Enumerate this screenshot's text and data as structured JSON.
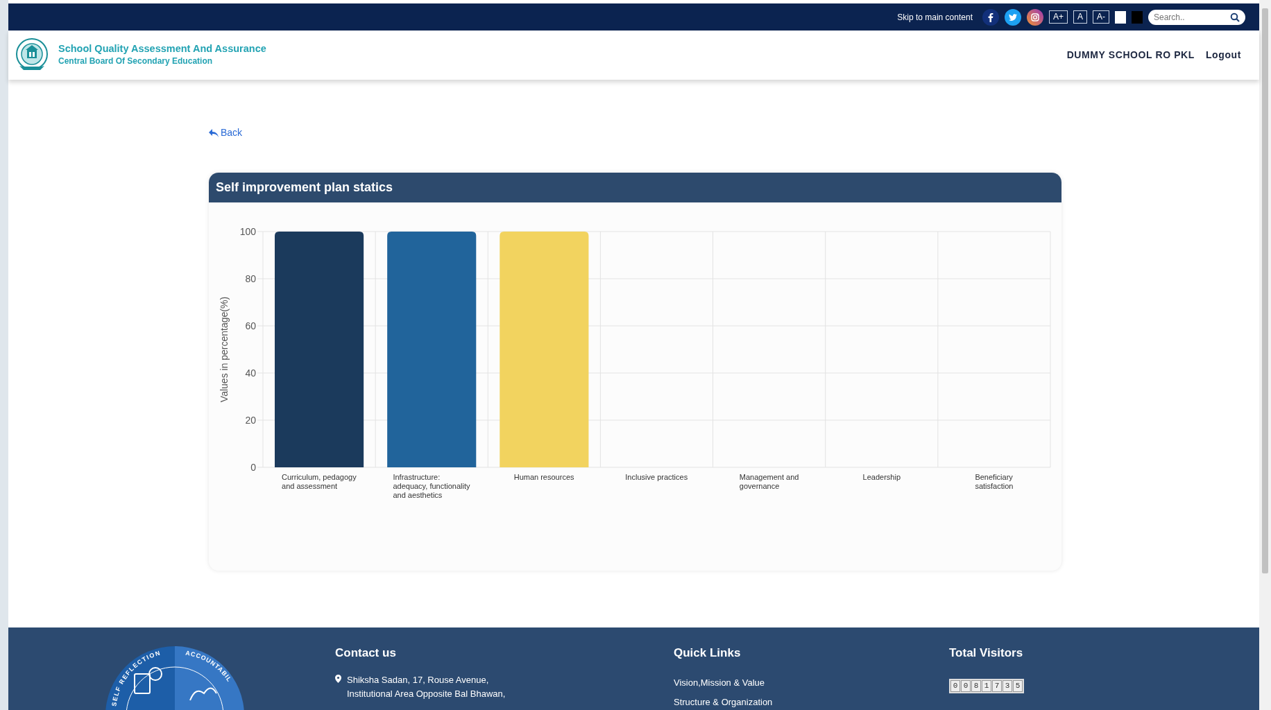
{
  "top_bar": {
    "skip_link": "Skip to main content",
    "font_buttons": [
      "A+",
      "A",
      "A-"
    ],
    "search": {
      "placeholder": "Search.."
    }
  },
  "header": {
    "title": "School Quality Assessment And Assurance",
    "subtitle": "Central Board Of Secondary Education",
    "nav": [
      "DUMMY SCHOOL RO PKL",
      "Logout"
    ]
  },
  "back_link": "Back",
  "card": {
    "title": "Self improvement plan statics",
    "chart_data": {
      "type": "bar",
      "ylabel": "Values in percentage(%)",
      "categories": [
        "Curriculum, pedagogy and assessment",
        "Infrastructure: adequacy, functionality and aesthetics",
        "Human resources",
        "Inclusive practices",
        "Management and governance",
        "Leadership",
        "Beneficiary satisfaction"
      ],
      "values": [
        100,
        100,
        100,
        0,
        0,
        0,
        0
      ],
      "ylim": [
        0,
        100
      ],
      "yticks": [
        0,
        20,
        40,
        60,
        80,
        100
      ],
      "grid": true
    }
  },
  "footer": {
    "logo_texts": [
      "SELF REFLECTION",
      "ACCOUNTABIL"
    ],
    "contact": {
      "heading": "Contact us",
      "address_lines": [
        "Shiksha Sadan, 17, Rouse Avenue,",
        "Institutional Area Opposite Bal Bhawan,"
      ]
    },
    "quick_links": {
      "heading": "Quick Links",
      "links": [
        "Vision,Mission & Value",
        "Structure & Organization"
      ]
    },
    "visitors": {
      "heading": "Total Visitors",
      "digits": [
        "0",
        "0",
        "8",
        "1",
        "7",
        "3",
        "5"
      ]
    }
  }
}
